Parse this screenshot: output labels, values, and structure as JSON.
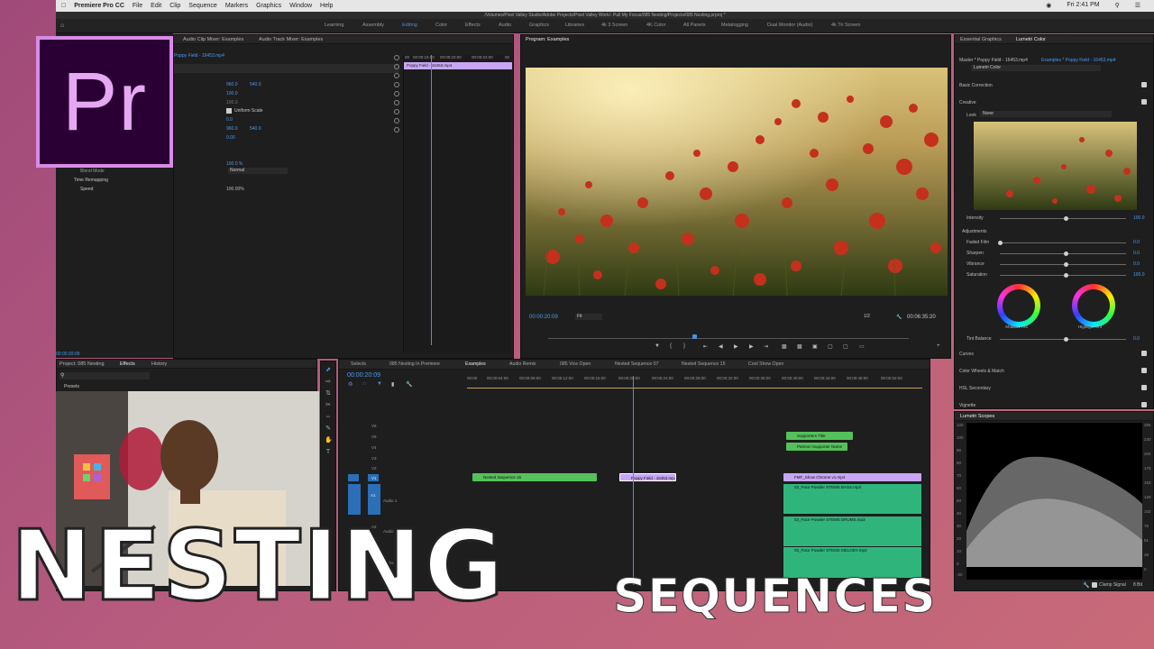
{
  "menubar": {
    "app": "Premiere Pro CC",
    "items": [
      "File",
      "Edit",
      "Clip",
      "Sequence",
      "Markers",
      "Graphics",
      "Window",
      "Help"
    ],
    "time": "Fri 2:41 PM"
  },
  "window_title": "/Volumes/Pixel Valley Studio/Adobe Projects/Pixel Valley Work/- Pull My Focus/085 Nesting/Projects/085 Nesting.prproj *",
  "workspaces": [
    "Learning",
    "Assembly",
    "Editing",
    "Color",
    "Effects",
    "Audio",
    "Graphics",
    "Libraries",
    "4k 3 Screen",
    "4K Color",
    "All Panels",
    "Metalogging",
    "Dual Monitor (Audio)",
    "4k Tri Screen"
  ],
  "active_workspace": "Editing",
  "logo_text": "Pr",
  "source_panel": {
    "tabs": [
      "Audio Clip Mixer: Examples",
      "Audio Track Mixer: Examples"
    ],
    "clip_label": "Poppy Field - 16453.mp4",
    "mini_ruler": [
      "00",
      "00:00:16:00",
      "00:00:22:00",
      "00:00:24:00",
      "00"
    ],
    "rows": [
      {
        "v1": "960.0",
        "v2": "540.0"
      },
      {
        "v1": "100.0"
      },
      {
        "v1": "100.0"
      },
      {
        "checkbox_label": "Uniform Scale"
      },
      {
        "v1": "0.0"
      },
      {
        "v1": "960.0",
        "v2": "540.0"
      },
      {
        "v1": "0.00"
      }
    ],
    "opacity": "100.0 %",
    "blend_mode_label": "Blend Mode",
    "blend_mode_value": "Normal",
    "time_remapping": "Time Remapping",
    "speed_label": "Speed",
    "speed_value": "100.00%",
    "timecode": "00:00:20:09"
  },
  "program_monitor": {
    "title": "Program: Examples",
    "timecode": "00:00:20:09",
    "fit": "Fit",
    "resolution": "1/2",
    "duration": "00:06:35:20"
  },
  "lumetri": {
    "tabs": [
      "Essential Graphics",
      "Lumetri Color"
    ],
    "master": "Master * Poppy Field - 16453.mp4",
    "seq": "Examples * Poppy Field - 16453.mp4",
    "preset": "Lumetri Color",
    "basic_correction": "Basic Correction",
    "creative": "Creative",
    "look_label": "Look",
    "look_value": "None",
    "intensity_label": "Intensity",
    "intensity_value": "100.0",
    "adjustments": "Adjustments",
    "faded_label": "Faded Film",
    "faded_value": "0.0",
    "sharpen_label": "Sharpen",
    "sharpen_value": "0.0",
    "vibrance_label": "Vibrance",
    "vibrance_value": "0.0",
    "saturation_label": "Saturation",
    "saturation_value": "100.0",
    "shadow_tint": "Shadow Tint",
    "highlight_tint": "Highlight Tint",
    "tint_balance_label": "Tint Balance",
    "tint_balance_value": "0.0",
    "sections": [
      "Curves",
      "Color Wheels & Match",
      "HSL Secondary",
      "Vignette"
    ]
  },
  "scopes": {
    "title": "Lumetri Scopes",
    "left_scale": [
      "120",
      "100",
      "90",
      "80",
      "70",
      "60",
      "50",
      "40",
      "30",
      "20",
      "10",
      "0",
      "-20"
    ],
    "right_scale": [
      "255",
      "230",
      "204",
      "178",
      "153",
      "128",
      "102",
      "76",
      "51",
      "26",
      "0"
    ],
    "clamp": "Clamp Signal",
    "bit": "8 Bit"
  },
  "project_panel": {
    "tabs": [
      "Project: 085 Nesting",
      "Effects",
      "History"
    ],
    "presets": "Presets"
  },
  "timeline": {
    "tabs": [
      "Selects",
      "085 Nesting In Premiere",
      "Examples",
      "Audio Remix",
      "085 Vice Open",
      "Nested Sequence 07",
      "Nested Sequence 15",
      "Cool Show Open"
    ],
    "active_tab": "Examples",
    "timecode": "00:00:20:09",
    "ruler": [
      "00:00",
      "00:00:04:00",
      "00:00:08:00",
      "00:00:12:00",
      "00:00:16:00",
      "00:00:20:00",
      "00:00:24:00",
      "00:00:28:00",
      "00:00:32:00",
      "00:00:36:00",
      "00:00:40:00",
      "00:00:44:00",
      "00:00:48:00",
      "00:00:52:00"
    ],
    "tracks": [
      "V6",
      "V5",
      "V4",
      "V3",
      "V2",
      "V1",
      "A1",
      "A2",
      "A3"
    ],
    "track_names": [
      "Audio 1",
      "Audio 2",
      "Audio 3"
    ],
    "clips": {
      "supporters_title": "Supporters Title",
      "patreon": "Patreon Supporter Name",
      "nested15": "Nested Sequence 15",
      "poppy": "Poppy Field - 16453.mp4",
      "fmf": "FMF_Show Chrome v1.mp4",
      "a1": "03_Face Powder STEMS BASS.mp3",
      "a2": "03_Face Powder STEMS DRUMS.mp3",
      "a3": "03_Face Powder STEMS MELODY.mp3"
    }
  },
  "overlay": {
    "big": "NESTING",
    "small": "SEQUENCES"
  },
  "colors": {
    "accent_blue": "#4a9bf0",
    "video_clip": "#55c15a",
    "nested_clip": "#c8a6f5",
    "audio_clip": "#2fb57c",
    "logo_bg": "#2a0034",
    "logo_border": "#d98ae6"
  }
}
